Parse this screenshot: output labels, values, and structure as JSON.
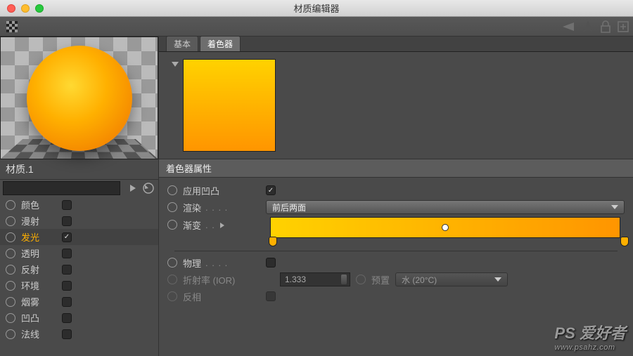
{
  "window": {
    "title": "材质编辑器"
  },
  "material": {
    "name": "材质.1"
  },
  "channels": [
    {
      "id": "color",
      "label": "颜色",
      "checked": false
    },
    {
      "id": "diffuse",
      "label": "漫射",
      "checked": false
    },
    {
      "id": "luminance",
      "label": "发光",
      "checked": true,
      "active": true
    },
    {
      "id": "transp",
      "label": "透明",
      "checked": false
    },
    {
      "id": "reflect",
      "label": "反射",
      "checked": false
    },
    {
      "id": "env",
      "label": "环境",
      "checked": false
    },
    {
      "id": "fog",
      "label": "烟雾",
      "checked": false
    },
    {
      "id": "bump",
      "label": "凹凸",
      "checked": false
    },
    {
      "id": "normal",
      "label": "法线",
      "checked": false
    }
  ],
  "tabs": {
    "basic": "基本",
    "shader": "着色器",
    "active": "shader"
  },
  "section": {
    "shaderProps": "着色器属性"
  },
  "props": {
    "applyBump": {
      "label": "应用凹凸",
      "checked": true
    },
    "render": {
      "label": "渲染",
      "value": "前后两面"
    },
    "gradient": {
      "label": "渐变",
      "knobPos": 50,
      "stops": [
        1,
        99
      ]
    },
    "physics": {
      "label": "物理",
      "checked": false
    },
    "ior": {
      "label": "折射率 (IOR)",
      "value": "1.333"
    },
    "preset": {
      "label": "预置",
      "value": "水 (20°C)"
    },
    "invert": {
      "label": "反相",
      "checked": false
    }
  },
  "colors": {
    "gradStart": "#ffd200",
    "gradEnd": "#ff9500"
  },
  "watermark": {
    "main": "PS 爱好者",
    "sub": "www.psahz.com"
  }
}
